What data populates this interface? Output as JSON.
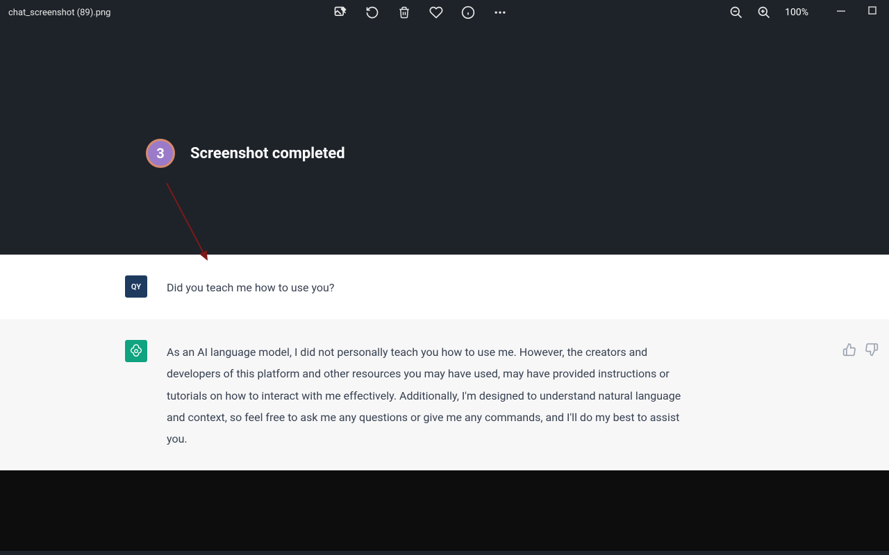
{
  "titlebar": {
    "filename": "chat_screenshot (89).png",
    "zoom_level": "100%"
  },
  "annotation": {
    "step_number": "3",
    "step_label": "Screenshot completed"
  },
  "chat": {
    "user": {
      "avatar_initials": "QY",
      "message": "Did you teach me how to use you?"
    },
    "assistant": {
      "message": "As an AI language model, I did not personally teach you how to use me. However, the creators and developers of this platform and other resources you may have used, may have provided instructions or tutorials on how to interact with me effectively. Additionally, I'm designed to understand natural language and context, so feel free to ask me any questions or give me any commands, and I'll do my best to assist you."
    }
  }
}
